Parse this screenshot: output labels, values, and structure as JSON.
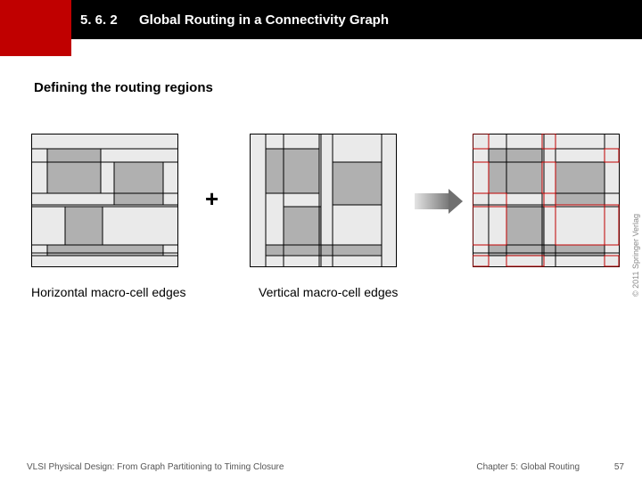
{
  "header": {
    "section_number": "5. 6. 2",
    "title": "Global Routing in a Connectivity Graph"
  },
  "subtitle": "Defining the routing regions",
  "plus_symbol": "+",
  "captions": {
    "left": "Horizontal macro-cell edges",
    "right": "Vertical macro-cell edges"
  },
  "copyright": "© 2011 Springer Verlag",
  "footer": {
    "left": "VLSI Physical Design: From Graph Partitioning to Timing Closure",
    "right": "Chapter 5: Global Routing",
    "page": "57"
  }
}
